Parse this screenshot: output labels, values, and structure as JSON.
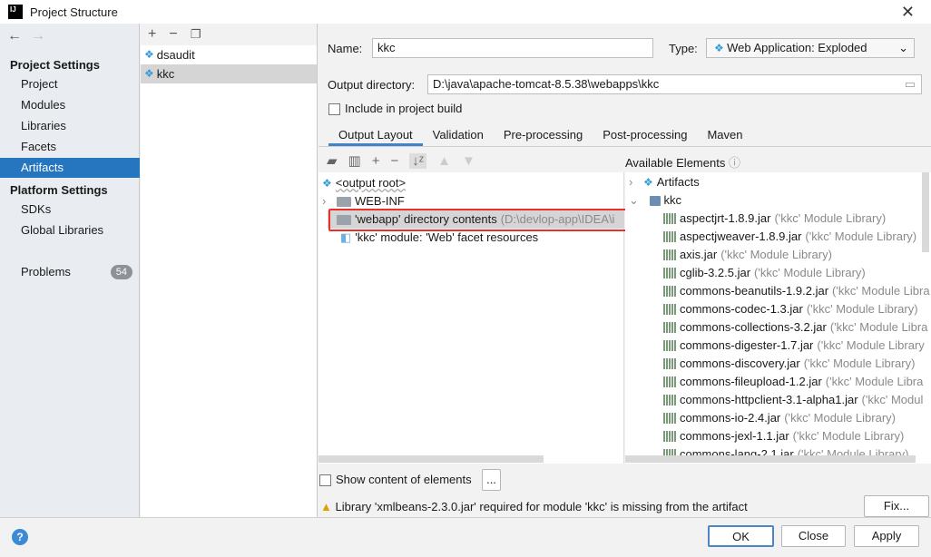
{
  "window": {
    "title": "Project Structure",
    "logo": "IJ"
  },
  "sidebar": {
    "project_settings": "Project Settings",
    "items1": [
      "Project",
      "Modules",
      "Libraries",
      "Facets",
      "Artifacts"
    ],
    "selected": "Artifacts",
    "platform_settings": "Platform Settings",
    "items2": [
      "SDKs",
      "Global Libraries"
    ],
    "problems": {
      "label": "Problems",
      "count": "54"
    }
  },
  "artifacts": [
    "dsaudit",
    "kkc"
  ],
  "form": {
    "name_label": "Name:",
    "name_value": "kkc",
    "type_label": "Type:",
    "type_value": "Web Application: Exploded",
    "output_label": "Output directory:",
    "output_value": "D:\\java\\apache-tomcat-8.5.38\\webapps\\kkc",
    "include_label": "Include in project build"
  },
  "tabs": [
    "Output Layout",
    "Validation",
    "Pre-processing",
    "Post-processing",
    "Maven"
  ],
  "layout_tree": [
    {
      "text": "<output root>",
      "extra": ""
    },
    {
      "text": "WEB-INF",
      "extra": ""
    },
    {
      "text": "'webapp' directory contents",
      "extra": "(D:\\devlop-app\\IDEA\\i"
    },
    {
      "text": "'kkc' module: 'Web' facet resources",
      "extra": ""
    }
  ],
  "available": {
    "header": "Available Elements",
    "artifacts": "Artifacts",
    "module": "kkc",
    "jars": [
      [
        "aspectjrt-1.8.9.jar",
        "('kkc' Module Library)"
      ],
      [
        "aspectjweaver-1.8.9.jar",
        "('kkc' Module Library)"
      ],
      [
        "axis.jar",
        "('kkc' Module Library)"
      ],
      [
        "cglib-3.2.5.jar",
        "('kkc' Module Library)"
      ],
      [
        "commons-beanutils-1.9.2.jar",
        "('kkc' Module Libra"
      ],
      [
        "commons-codec-1.3.jar",
        "('kkc' Module Library)"
      ],
      [
        "commons-collections-3.2.jar",
        "('kkc' Module Libra"
      ],
      [
        "commons-digester-1.7.jar",
        "('kkc' Module Library"
      ],
      [
        "commons-discovery.jar",
        "('kkc' Module Library)"
      ],
      [
        "commons-fileupload-1.2.jar",
        "('kkc' Module Libra"
      ],
      [
        "commons-httpclient-3.1-alpha1.jar",
        "('kkc' Modul"
      ],
      [
        "commons-io-2.4.jar",
        "('kkc' Module Library)"
      ],
      [
        "commons-jexl-1.1.jar",
        "('kkc' Module Library)"
      ],
      [
        "commons-lang-2.1.jar",
        "('kkc' Module Library)"
      ]
    ]
  },
  "show_content": "Show content of elements",
  "ellipsis": "...",
  "warning": "Library 'xmlbeans-2.3.0.jar' required for module 'kkc' is missing from the artifact",
  "buttons": {
    "fix": "Fix...",
    "ok": "OK",
    "close": "Close",
    "apply": "Apply",
    "help": "?"
  },
  "colors": {
    "selection": "#2675bf",
    "highlight_box": "#e8302a"
  }
}
